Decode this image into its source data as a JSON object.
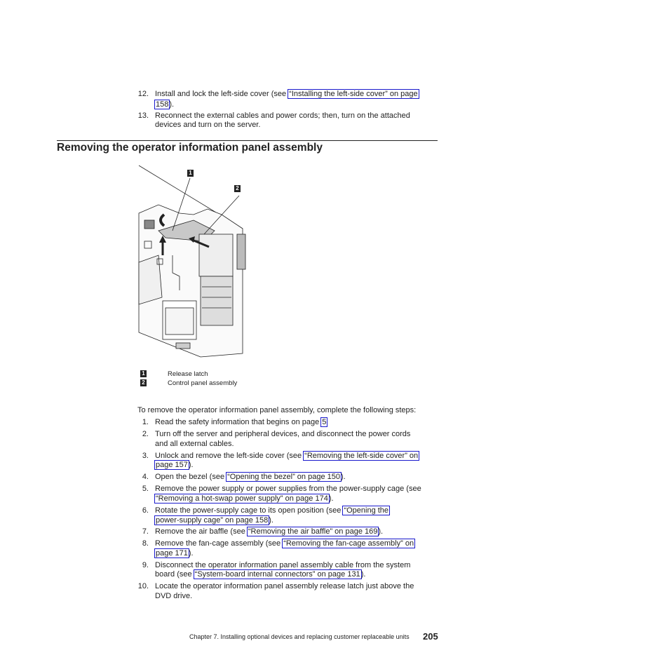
{
  "prev_steps": [
    {
      "num": "12.",
      "pre": "Install and lock the left-side cover (see ",
      "link1": "“Installing the left-side cover” on page",
      "link2": "158",
      "post": ")."
    },
    {
      "num": "13.",
      "line1": "Reconnect the external cables and power cords; then, turn on the attached",
      "line2": "devices and turn on the server."
    }
  ],
  "section_title": "Removing the operator information panel assembly",
  "figure": {
    "callouts": [
      {
        "id": "1",
        "label": "Release latch"
      },
      {
        "id": "2",
        "label": "Control panel assembly"
      }
    ]
  },
  "intro": "To remove the operator information panel assembly, complete the following steps:",
  "steps": [
    {
      "num": "1.",
      "pre": "Read the safety information that begins on page ",
      "link": "5",
      "post": ""
    },
    {
      "num": "2.",
      "line1": "Turn off the server and peripheral devices, and disconnect the power cords",
      "line2": "and all external cables."
    },
    {
      "num": "3.",
      "pre": "Unlock and remove the left-side cover (see ",
      "link1": "“Removing the left-side cover” on",
      "link2": "page 157",
      "post": ")."
    },
    {
      "num": "4.",
      "pre": "Open the bezel (see ",
      "link": "“Opening the bezel” on page 150",
      "post": ")."
    },
    {
      "num": "5.",
      "line1": "Remove the power supply or power supplies from the power-supply cage (see",
      "link": "“Removing a hot-swap power supply” on page 174",
      "post": ")."
    },
    {
      "num": "6.",
      "pre": "Rotate the power-supply cage to its open position (see ",
      "link1": "“Opening the",
      "link2": "power-supply cage” on page 158",
      "post": ")."
    },
    {
      "num": "7.",
      "pre": "Remove the air baffle (see ",
      "link": "“Removing the air baffle” on page 169",
      "post": ")."
    },
    {
      "num": "8.",
      "pre": "Remove the fan-cage assembly (see ",
      "link1": "“Removing the fan-cage assembly” on",
      "link2": "page 171",
      "post": ")."
    },
    {
      "num": "9.",
      "line1": "Disconnect the operator information panel assembly cable from the system",
      "pre": "board (see ",
      "link": "“System-board internal connectors” on page 131",
      "post": ")."
    },
    {
      "num": "10.",
      "line1": "Locate the operator information panel assembly release latch just above the",
      "line2": "DVD drive."
    }
  ],
  "footer": {
    "chapter": "Chapter 7. Installing optional devices and replacing customer replaceable units",
    "page": "205"
  }
}
